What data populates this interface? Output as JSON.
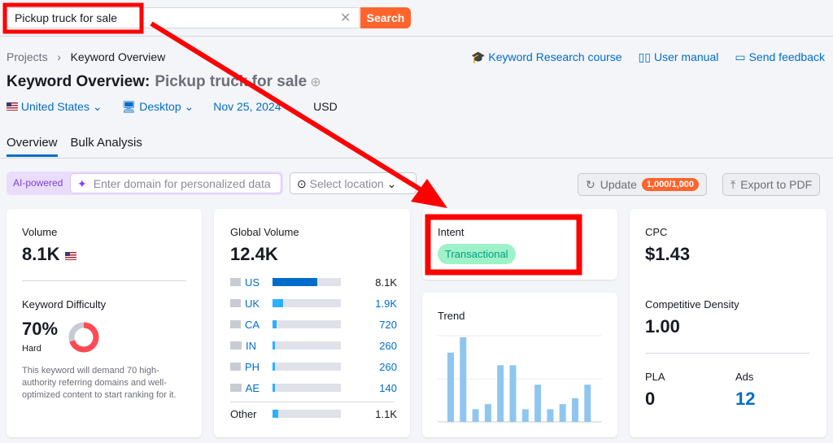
{
  "search": {
    "value": "Pickup truck for sale",
    "clear_icon": "close-icon",
    "button": "Search"
  },
  "breadcrumb": [
    "Projects",
    "Keyword Overview"
  ],
  "links": [
    {
      "icon": "graduation-cap-icon",
      "label": "Keyword Research course"
    },
    {
      "icon": "book-icon",
      "label": "User manual"
    },
    {
      "icon": "chat-icon",
      "label": "Send feedback"
    }
  ],
  "title": {
    "prefix": "Keyword Overview:",
    "keyword": "Pickup truck for sale"
  },
  "filters": {
    "country": "United States",
    "device": "Desktop",
    "date": "Nov 25, 2024",
    "currency": "USD"
  },
  "tabs": [
    "Overview",
    "Bulk Analysis"
  ],
  "ai": {
    "badge": "AI-powered",
    "placeholder": "Enter domain for personalized data",
    "location": "Select location"
  },
  "update": {
    "label": "Update",
    "badge": "1,000/1,000"
  },
  "export": "Export to PDF",
  "volume": {
    "label": "Volume",
    "value": "8.1K"
  },
  "kd": {
    "label": "Keyword Difficulty",
    "value": "70%",
    "percent": 70,
    "level": "Hard",
    "desc": "This keyword will demand 70 high-authority referring domains and well-optimized content to start ranking for it.",
    "color": "#ff4953"
  },
  "global": {
    "label": "Global Volume",
    "value": "12.4K",
    "rows": [
      {
        "cc": "US",
        "val": "8.1K",
        "pct": 65,
        "color": "#006dca"
      },
      {
        "cc": "UK",
        "val": "1.9K",
        "pct": 15,
        "color": "#2bb0ff"
      },
      {
        "cc": "CA",
        "val": "720",
        "pct": 6,
        "color": "#2bb0ff"
      },
      {
        "cc": "IN",
        "val": "260",
        "pct": 4,
        "color": "#2bb0ff"
      },
      {
        "cc": "PH",
        "val": "260",
        "pct": 4,
        "color": "#2bb0ff"
      },
      {
        "cc": "AE",
        "val": "140",
        "pct": 4,
        "color": "#2bb0ff"
      }
    ],
    "other": {
      "label": "Other",
      "val": "1.1K",
      "pct": 8
    }
  },
  "intent": {
    "label": "Intent",
    "value": "Transactional"
  },
  "trend": {
    "label": "Trend",
    "values": [
      0.82,
      1.0,
      0.15,
      0.21,
      0.67,
      0.67,
      0.15,
      0.44,
      0.15,
      0.21,
      0.28,
      0.44
    ]
  },
  "cpc": {
    "label": "CPC",
    "value": "$1.43"
  },
  "density": {
    "label": "Competitive Density",
    "value": "1.00"
  },
  "pla": {
    "label": "PLA",
    "value": "0"
  },
  "ads": {
    "label": "Ads",
    "value": "12"
  }
}
